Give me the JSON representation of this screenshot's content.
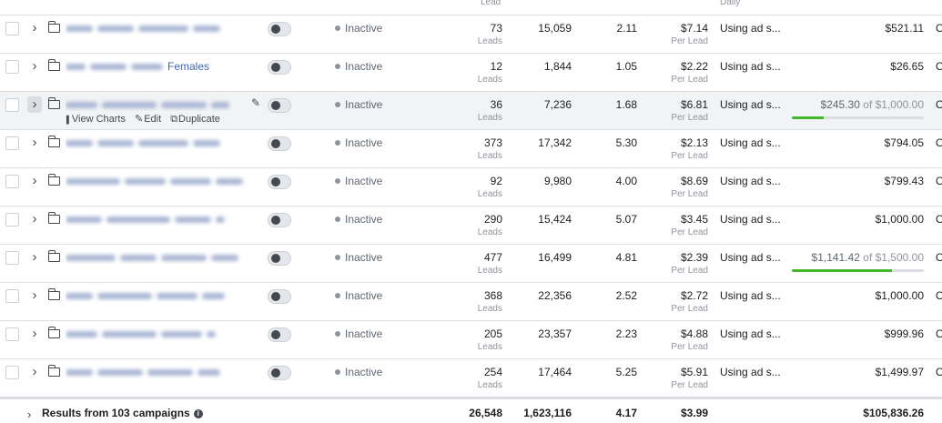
{
  "columns": {
    "results_header": "Lead",
    "budget_header": "Daily"
  },
  "icons": {
    "expand": "chevron-right-icon",
    "folder": "folder-icon",
    "toggle": "toggle-switch",
    "edit": "pencil-icon",
    "info": "info-icon"
  },
  "colors": {
    "link": "#4267b2",
    "progress": "#42b72a",
    "status_dot": "#8d949e"
  },
  "row_actions": {
    "view_charts": "View Charts",
    "edit": "Edit",
    "duplicate": "Duplicate"
  },
  "rows": [
    {
      "name": "",
      "status": "Inactive",
      "results": "73",
      "results_unit": "Leads",
      "reach": "15,059",
      "frequency": "2.11",
      "cost": "$7.14",
      "cost_unit": "Per Lead",
      "bid": "Using ad s...",
      "budget": "$521.11",
      "edge": "O"
    },
    {
      "name": "Females",
      "status": "Inactive",
      "results": "12",
      "results_unit": "Leads",
      "reach": "1,844",
      "frequency": "1.05",
      "cost": "$2.22",
      "cost_unit": "Per Lead",
      "bid": "Using ad s...",
      "budget": "$26.65",
      "edge": "O"
    },
    {
      "name": "",
      "status": "Inactive",
      "results": "36",
      "results_unit": "Leads",
      "reach": "7,236",
      "frequency": "1.68",
      "cost": "$6.81",
      "cost_unit": "Per Lead",
      "bid": "Using ad s...",
      "budget_spent": "$245.30",
      "budget_of": "of $1,000.00",
      "progress": 0.24,
      "edge": "O"
    },
    {
      "name": "",
      "status": "Inactive",
      "results": "373",
      "results_unit": "Leads",
      "reach": "17,342",
      "frequency": "5.30",
      "cost": "$2.13",
      "cost_unit": "Per Lead",
      "bid": "Using ad s...",
      "budget": "$794.05",
      "edge": "O"
    },
    {
      "name": "",
      "status": "Inactive",
      "results": "92",
      "results_unit": "Leads",
      "reach": "9,980",
      "frequency": "4.00",
      "cost": "$8.69",
      "cost_unit": "Per Lead",
      "bid": "Using ad s...",
      "budget": "$799.43",
      "edge": "O"
    },
    {
      "name": "",
      "status": "Inactive",
      "results": "290",
      "results_unit": "Leads",
      "reach": "15,424",
      "frequency": "5.07",
      "cost": "$3.45",
      "cost_unit": "Per Lead",
      "bid": "Using ad s...",
      "budget": "$1,000.00",
      "edge": "O"
    },
    {
      "name": "",
      "status": "Inactive",
      "results": "477",
      "results_unit": "Leads",
      "reach": "16,499",
      "frequency": "4.81",
      "cost": "$2.39",
      "cost_unit": "Per Lead",
      "bid": "Using ad s...",
      "budget_spent": "$1,141.42",
      "budget_of": "of $1,500.00",
      "progress": 0.76,
      "edge": "O"
    },
    {
      "name": "",
      "status": "Inactive",
      "results": "368",
      "results_unit": "Leads",
      "reach": "22,356",
      "frequency": "2.52",
      "cost": "$2.72",
      "cost_unit": "Per Lead",
      "bid": "Using ad s...",
      "budget": "$1,000.00",
      "edge": "O"
    },
    {
      "name": "",
      "status": "Inactive",
      "results": "205",
      "results_unit": "Leads",
      "reach": "23,357",
      "frequency": "2.23",
      "cost": "$4.88",
      "cost_unit": "Per Lead",
      "bid": "Using ad s...",
      "budget": "$999.96",
      "edge": "O"
    },
    {
      "name": "",
      "status": "Inactive",
      "results": "254",
      "results_unit": "Leads",
      "reach": "17,464",
      "frequency": "5.25",
      "cost": "$5.91",
      "cost_unit": "Per Lead",
      "bid": "Using ad s...",
      "budget": "$1,499.97",
      "edge": "O"
    }
  ],
  "footer": {
    "label": "Results from 103 campaigns",
    "results": "26,548",
    "reach": "1,623,116",
    "frequency": "4.17",
    "cost": "$3.99",
    "budget": "$105,836.26"
  }
}
